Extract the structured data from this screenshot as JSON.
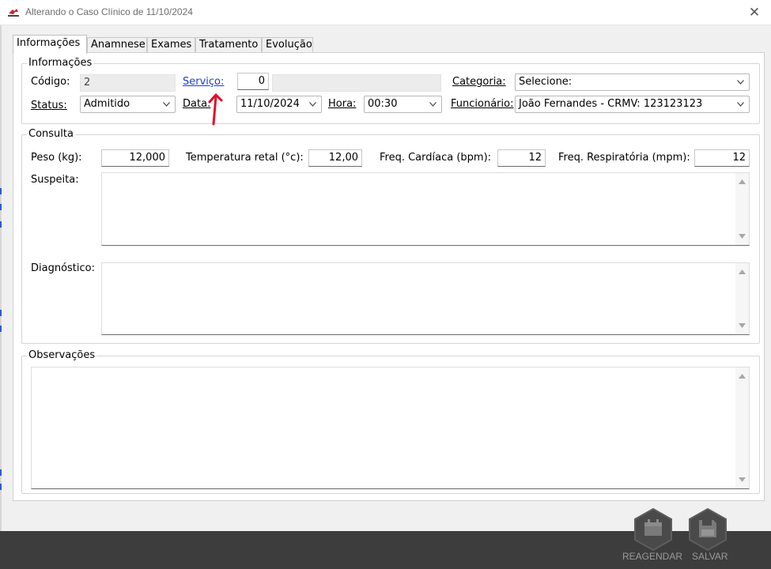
{
  "window": {
    "title": "Alterando o Caso Clínico de 11/10/2024",
    "close_glyph": "✕",
    "icon": "app-logo-icon"
  },
  "tabs": [
    {
      "label": "Informações",
      "active": true
    },
    {
      "label": "Anamnese",
      "active": false
    },
    {
      "label": "Exames",
      "active": false
    },
    {
      "label": "Tratamento",
      "active": false
    },
    {
      "label": "Evolução",
      "active": false
    }
  ],
  "informacoes": {
    "legend": "Informações",
    "codigo": {
      "label": "Código:",
      "value": "2"
    },
    "servico": {
      "label": "Serviço:",
      "code": "0",
      "description": ""
    },
    "categoria": {
      "label": "Categoria:",
      "value": "Selecione:"
    },
    "status": {
      "label": "Status:",
      "value": "Admitido"
    },
    "data": {
      "label": "Data:",
      "value": "11/10/2024"
    },
    "hora": {
      "label": "Hora:",
      "value": "00:30"
    },
    "funcionario": {
      "label": "Funcionário:",
      "value": "João Fernandes - CRMV: 123123123"
    }
  },
  "consulta": {
    "legend": "Consulta",
    "peso": {
      "label": "Peso (kg):",
      "value": "12,000"
    },
    "temperatura": {
      "label": "Temperatura retal (°c):",
      "value": "12,00"
    },
    "freq_cardiaca": {
      "label": "Freq. Cardíaca (bpm):",
      "value": "12"
    },
    "freq_respiratoria": {
      "label": "Freq. Respiratória (mpm):",
      "value": "12"
    },
    "suspeita": {
      "label": "Suspeita:",
      "value": ""
    },
    "diagnostico": {
      "label": "Diagnóstico:",
      "value": ""
    }
  },
  "observacoes": {
    "legend": "Observações",
    "value": ""
  },
  "footer": {
    "reagendar_label": "REAGENDAR",
    "salvar_label": "SALVAR"
  },
  "colors": {
    "link": "#1a3fd4",
    "footer_bg": "#3d3d3d",
    "annotation": "#e0102a"
  }
}
